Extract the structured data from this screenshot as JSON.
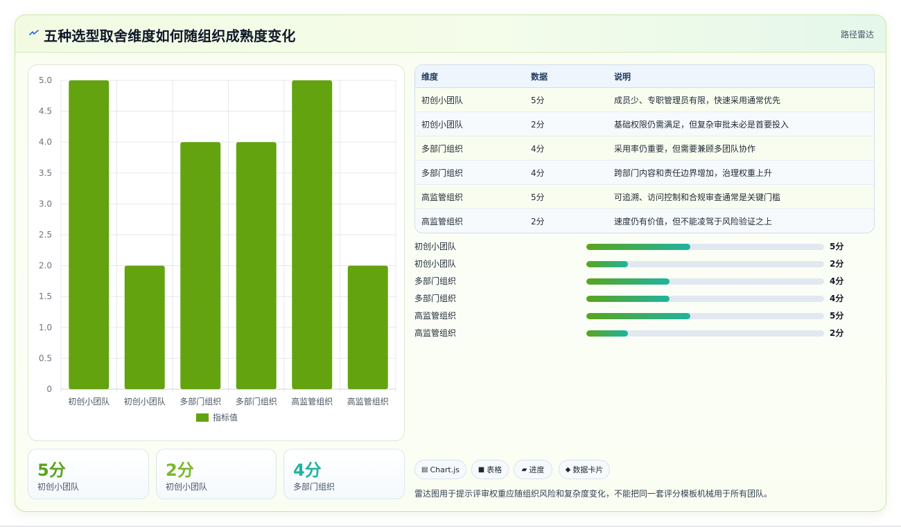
{
  "header": {
    "icon": "lightning-icon",
    "title": "五种选型取舍维度如何随组织成熟度变化",
    "link_label": "路径雷达"
  },
  "colors": {
    "bar": "#63a30f",
    "accent_green": "#5aa41c",
    "accent_teal": "#1fb3a0"
  },
  "chart_data": {
    "type": "bar",
    "categories": [
      "初创小团队",
      "初创小团队",
      "多部门组织",
      "多部门组织",
      "高监管组织",
      "高监管组织"
    ],
    "series": [
      {
        "name": "指标值",
        "values": [
          5,
          2,
          4,
          4,
          5,
          2
        ]
      }
    ],
    "ylim": [
      0,
      5
    ],
    "yticks": [
      "0",
      "0.5",
      "1.0",
      "1.5",
      "2.0",
      "2.5",
      "3.0",
      "3.5",
      "4.0",
      "4.5",
      "5.0"
    ],
    "grid": true,
    "legend": "bottom"
  },
  "stats": [
    {
      "value": "5分",
      "label": "初创小团队",
      "color": "#5aa41c"
    },
    {
      "value": "2分",
      "label": "初创小团队",
      "color": "#7ab828"
    },
    {
      "value": "4分",
      "label": "多部门组织",
      "color": "#1fb3a0"
    }
  ],
  "table": {
    "columns": [
      "维度",
      "数据",
      "说明"
    ],
    "rows": [
      [
        "初创小团队",
        "5分",
        "成员少、专职管理员有限，快速采用通常优先"
      ],
      [
        "初创小团队",
        "2分",
        "基础权限仍需满足，但复杂审批未必是首要投入"
      ],
      [
        "多部门组织",
        "4分",
        "采用率仍重要，但需要兼顾多团队协作"
      ],
      [
        "多部门组织",
        "4分",
        "跨部门内容和责任边界增加，治理权重上升"
      ],
      [
        "高监管组织",
        "5分",
        "可追溯、访问控制和合规审查通常是关键门槛"
      ],
      [
        "高监管组织",
        "2分",
        "速度仍有价值，但不能凌驾于风险验证之上"
      ]
    ]
  },
  "progress": [
    {
      "label": "初创小团队",
      "value": "5分",
      "fraction": 0.4375
    },
    {
      "label": "初创小团队",
      "value": "2分",
      "fraction": 0.175
    },
    {
      "label": "多部门组织",
      "value": "4分",
      "fraction": 0.35
    },
    {
      "label": "多部门组织",
      "value": "4分",
      "fraction": 0.35
    },
    {
      "label": "高监管组织",
      "value": "5分",
      "fraction": 0.4375
    },
    {
      "label": "高监管组织",
      "value": "2分",
      "fraction": 0.175
    }
  ],
  "chips": [
    {
      "icon": "chart-icon",
      "glyph": "▤",
      "label": "Chart.js"
    },
    {
      "icon": "table-icon",
      "glyph": "■",
      "label": "表格"
    },
    {
      "icon": "progress-icon",
      "glyph": "▰",
      "label": "进度"
    },
    {
      "icon": "card-icon",
      "glyph": "◆",
      "label": "数据卡片"
    }
  ],
  "footnote": "雷达图用于提示评审权重应随组织风险和复杂度变化，不能把同一套评分模板机械用于所有团队。"
}
